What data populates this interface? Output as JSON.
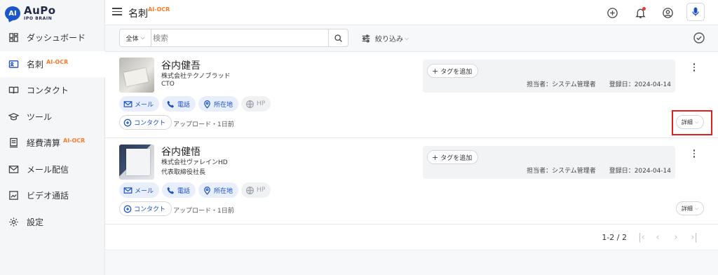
{
  "app": {
    "logo_main": "AuPo",
    "logo_sub": "IPO BRAIN",
    "logo_bubble": "AI"
  },
  "sidebar": {
    "items": [
      {
        "label": "ダッシュボード",
        "icon": "dashboard-icon",
        "badge": ""
      },
      {
        "label": "名刺",
        "icon": "business-card-icon",
        "badge": "AI-OCR",
        "active": true
      },
      {
        "label": "コンタクト",
        "icon": "book-icon",
        "badge": ""
      },
      {
        "label": "ツール",
        "icon": "graduation-cap-icon",
        "badge": ""
      },
      {
        "label": "経費清算",
        "icon": "receipt-icon",
        "badge": "AI-OCR"
      },
      {
        "label": "メール配信",
        "icon": "mail-icon",
        "badge": ""
      },
      {
        "label": "ビデオ通話",
        "icon": "video-icon",
        "badge": ""
      },
      {
        "label": "設定",
        "icon": "gear-icon",
        "badge": ""
      }
    ]
  },
  "header": {
    "title": "名刺",
    "title_badge": "AI-OCR"
  },
  "search": {
    "scope": "全体",
    "placeholder": "検索",
    "filter_label": "絞り込み"
  },
  "cards": [
    {
      "name": "谷内健吾",
      "company": "株式会社テクノブラッド",
      "role": "CTO",
      "chips": [
        "メール",
        "電話",
        "所在地",
        "HP"
      ],
      "contact_label": "コンタクト",
      "upload_meta": "アップロード・1日前",
      "tag_button": "タグを追加",
      "assignee": "担当者：システム管理者",
      "registered": "登録日：2024-04-14",
      "detail_label": "詳細"
    },
    {
      "name": "谷内健悟",
      "company": "株式会社ヴァレインHD",
      "role": "代表取締役社長",
      "chips": [
        "メール",
        "電話",
        "所在地",
        "HP"
      ],
      "contact_label": "コンタクト",
      "upload_meta": "アップロード・1日前",
      "tag_button": "タグを追加",
      "assignee": "担当者：システム管理者",
      "registered": "登録日：2024-04-14",
      "detail_label": "詳細"
    }
  ],
  "pagination": {
    "info": "1-2 / 2"
  },
  "colors": {
    "accent": "#1a4fc4",
    "badge": "#ff7a2a",
    "highlight": "#e02020"
  }
}
